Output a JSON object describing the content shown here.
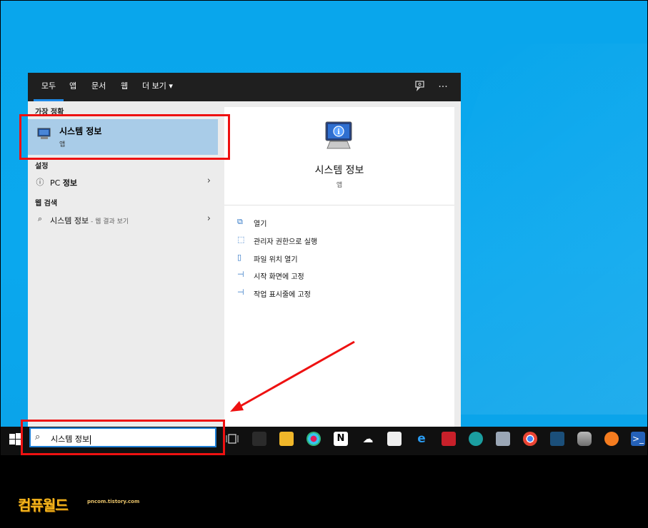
{
  "tabs": {
    "all": "모두",
    "apps": "앱",
    "documents": "문서",
    "web": "웹",
    "more": "더 보기 ▾"
  },
  "top_icons": {
    "feedback": "feedback-icon",
    "more": "···"
  },
  "best_match": {
    "header": "가장 정확",
    "title": "시스템 정보",
    "subtitle": "앱"
  },
  "settings": {
    "header": "설정",
    "item_prefix": "PC ",
    "item_bold": "정보"
  },
  "web_search": {
    "header": "웹 검색",
    "query": "시스템 정보",
    "suffix": " - 웹 결과 보기"
  },
  "detail": {
    "title": "시스템 정보",
    "subtitle": "앱",
    "actions": [
      {
        "label": "열기",
        "icon": "open-icon"
      },
      {
        "label": "관리자 권한으로 실행",
        "icon": "run-as-admin-icon"
      },
      {
        "label": "파일 위치 열기",
        "icon": "file-location-icon"
      },
      {
        "label": "시작 화면에 고정",
        "icon": "pin-icon"
      },
      {
        "label": "작업 표시줄에 고정",
        "icon": "pin-icon"
      }
    ]
  },
  "search_box": {
    "value": "시스템 정보"
  },
  "watermark": {
    "logo": "컴퓨월드",
    "url": "pncom.tistory.com"
  },
  "colors": {
    "accent": "#1e7fd6",
    "highlight": "#a9cce8",
    "annotation": "#ee1111",
    "desktop": "#09a6ec"
  }
}
